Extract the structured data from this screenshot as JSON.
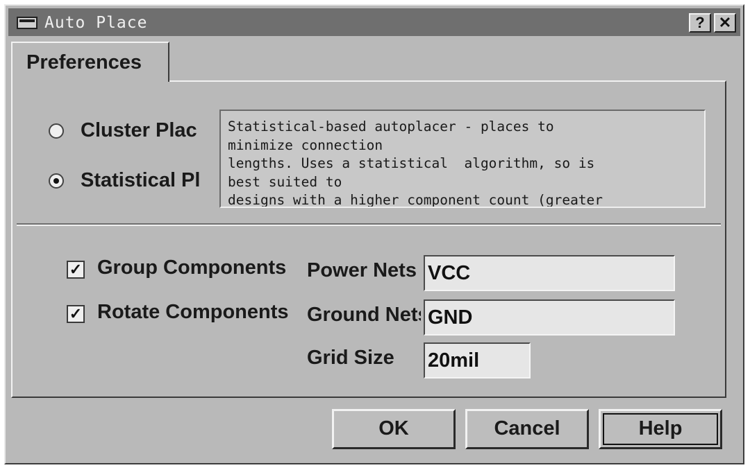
{
  "window": {
    "title": "Auto Place"
  },
  "titlebar": {
    "help_label": "?",
    "close_label": "✕"
  },
  "tabs": [
    {
      "label": "Preferences"
    }
  ],
  "placement": {
    "options": [
      {
        "label": "Cluster Plac",
        "selected": false
      },
      {
        "label": "Statistical Pl",
        "selected": true
      }
    ],
    "description": "Statistical-based autoplacer - places to\nminimize connection\nlengths. Uses a statistical  algorithm, so is\nbest suited to\ndesigns with a higher component count (greater"
  },
  "options": {
    "group_components": {
      "label": "Group Components",
      "checked": true
    },
    "rotate_components": {
      "label": "Rotate Components",
      "checked": true
    }
  },
  "fields": {
    "power_nets": {
      "label": "Power Nets",
      "value": "VCC"
    },
    "ground_nets": {
      "label": "Ground Nets",
      "value": "GND"
    },
    "grid_size": {
      "label": "Grid Size",
      "value": "20mil"
    }
  },
  "buttons": {
    "ok": "OK",
    "cancel": "Cancel",
    "help": "Help"
  },
  "checkmark": "✓"
}
